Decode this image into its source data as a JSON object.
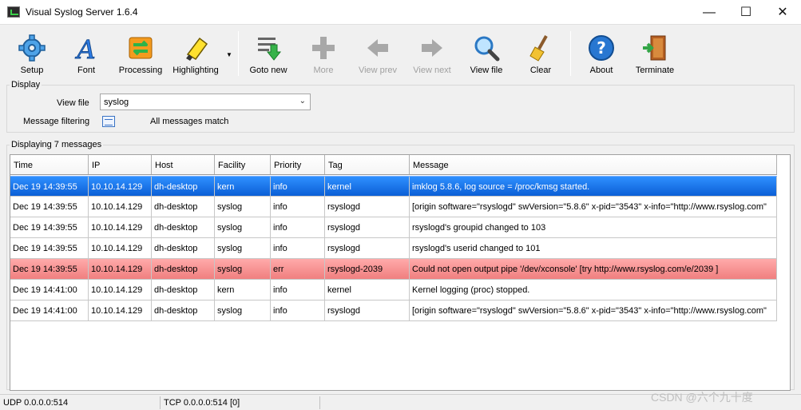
{
  "window": {
    "title": "Visual Syslog Server 1.6.4",
    "minimize": "—",
    "maximize": "☐",
    "close": "✕"
  },
  "toolbar": {
    "setup": "Setup",
    "font": "Font",
    "processing": "Processing",
    "highlighting": "Highlighting",
    "goto_new": "Goto new",
    "more": "More",
    "view_prev": "View prev",
    "view_next": "View next",
    "view_file": "View file",
    "clear": "Clear",
    "about": "About",
    "terminate": "Terminate"
  },
  "display": {
    "group_title": "Display",
    "view_file_label": "View file",
    "view_file_value": "syslog",
    "filter_label": "Message filtering",
    "filter_status": "All messages match"
  },
  "messages": {
    "group_title": "Displaying 7 messages",
    "columns": [
      "Time",
      "IP",
      "Host",
      "Facility",
      "Priority",
      "Tag",
      "Message"
    ],
    "rows": [
      [
        "Dec 19 14:39:55",
        "10.10.14.129",
        "dh-desktop",
        "kern",
        "info",
        "kernel",
        "imklog 5.8.6, log source = /proc/kmsg started."
      ],
      [
        "Dec 19 14:39:55",
        "10.10.14.129",
        "dh-desktop",
        "syslog",
        "info",
        "rsyslogd",
        "[origin software=\"rsyslogd\" swVersion=\"5.8.6\" x-pid=\"3543\" x-info=\"http://www.rsyslog.com\""
      ],
      [
        "Dec 19 14:39:55",
        "10.10.14.129",
        "dh-desktop",
        "syslog",
        "info",
        "rsyslogd",
        "rsyslogd's groupid changed to 103"
      ],
      [
        "Dec 19 14:39:55",
        "10.10.14.129",
        "dh-desktop",
        "syslog",
        "info",
        "rsyslogd",
        "rsyslogd's userid changed to 101"
      ],
      [
        "Dec 19 14:39:55",
        "10.10.14.129",
        "dh-desktop",
        "syslog",
        "err",
        "rsyslogd-2039",
        "Could not open output pipe '/dev/xconsole' [try http://www.rsyslog.com/e/2039 ]"
      ],
      [
        "Dec 19 14:41:00",
        "10.10.14.129",
        "dh-desktop",
        "kern",
        "info",
        "kernel",
        "Kernel logging (proc) stopped."
      ],
      [
        "Dec 19 14:41:00",
        "10.10.14.129",
        "dh-desktop",
        "syslog",
        "info",
        "rsyslogd",
        "[origin software=\"rsyslogd\" swVersion=\"5.8.6\" x-pid=\"3543\" x-info=\"http://www.rsyslog.com\""
      ]
    ]
  },
  "statusbar": {
    "udp": "UDP 0.0.0.0:514",
    "tcp": "TCP 0.0.0.0:514 [0]"
  },
  "watermark": "CSDN @六个九十度"
}
